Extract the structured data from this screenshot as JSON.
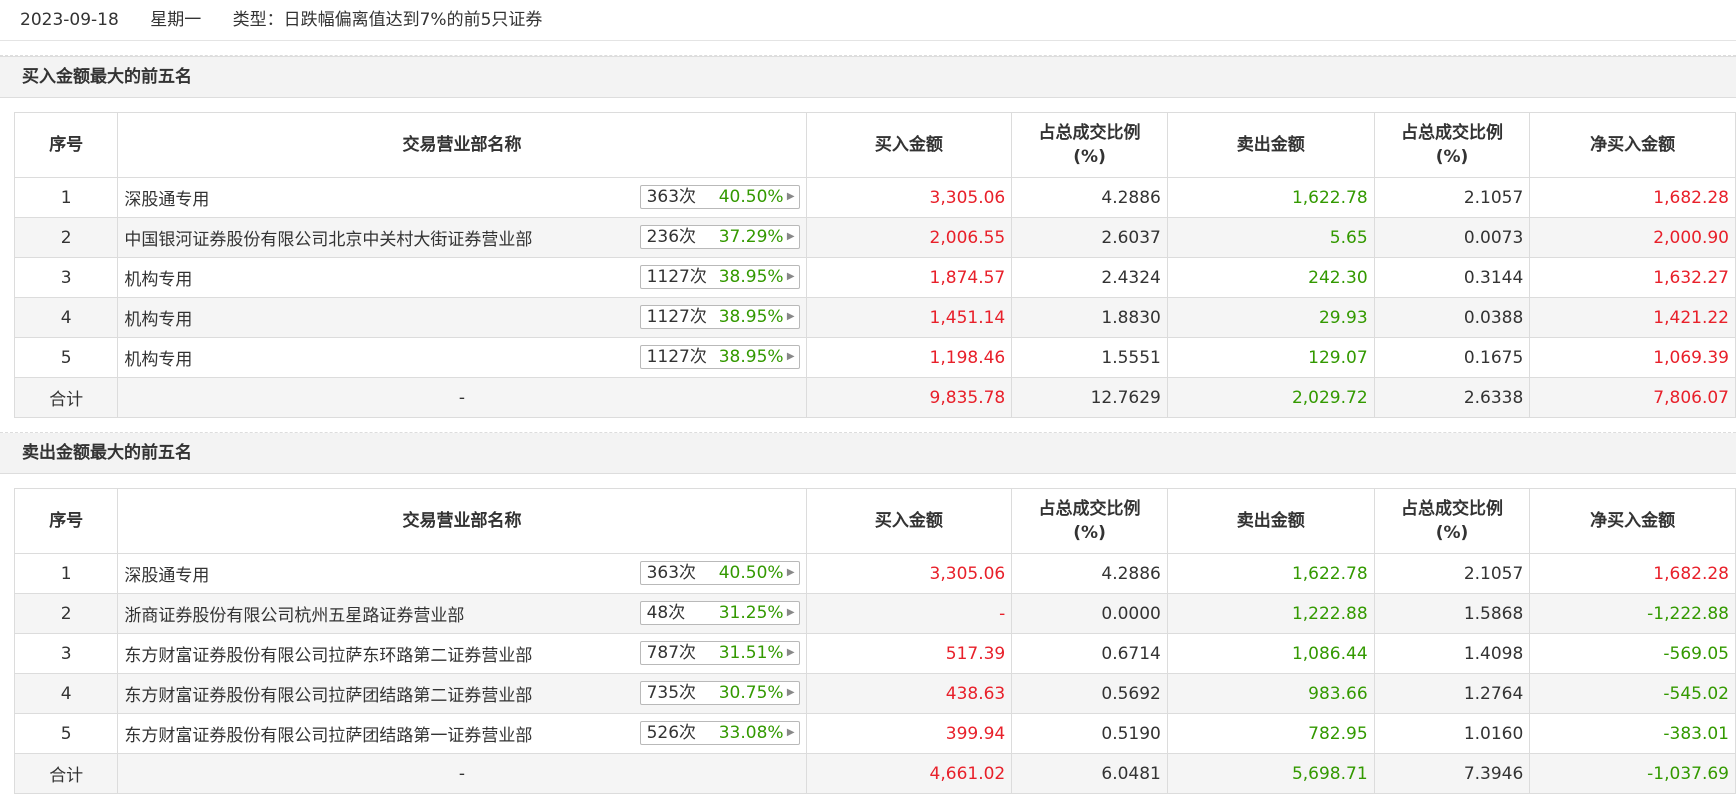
{
  "header": {
    "date": "2023-09-18",
    "weekday": "星期一",
    "type_label": "类型：日跌幅偏离值达到7%的前5只证券"
  },
  "columns": [
    "序号",
    "交易营业部名称",
    "买入金额",
    "占总成交比例\n(%)",
    "卖出金额",
    "占总成交比例\n(%)",
    "净买入金额"
  ],
  "buy_section": {
    "title": "买入金额最大的前五名",
    "rows": [
      {
        "idx": "1",
        "name": "深股通专用",
        "count": "363次",
        "rate": "40.50%",
        "buy": "3,305.06",
        "buy_pct": "4.2886",
        "sell": "1,622.78",
        "sell_pct": "2.1057",
        "net": "1,682.28"
      },
      {
        "idx": "2",
        "name": "中国银河证券股份有限公司北京中关村大街证券营业部",
        "count": "236次",
        "rate": "37.29%",
        "buy": "2,006.55",
        "buy_pct": "2.6037",
        "sell": "5.65",
        "sell_pct": "0.0073",
        "net": "2,000.90"
      },
      {
        "idx": "3",
        "name": "机构专用",
        "count": "1127次",
        "rate": "38.95%",
        "buy": "1,874.57",
        "buy_pct": "2.4324",
        "sell": "242.30",
        "sell_pct": "0.3144",
        "net": "1,632.27"
      },
      {
        "idx": "4",
        "name": "机构专用",
        "count": "1127次",
        "rate": "38.95%",
        "buy": "1,451.14",
        "buy_pct": "1.8830",
        "sell": "29.93",
        "sell_pct": "0.0388",
        "net": "1,421.22"
      },
      {
        "idx": "5",
        "name": "机构专用",
        "count": "1127次",
        "rate": "38.95%",
        "buy": "1,198.46",
        "buy_pct": "1.5551",
        "sell": "129.07",
        "sell_pct": "0.1675",
        "net": "1,069.39"
      }
    ],
    "total": {
      "label": "合计",
      "name": "-",
      "buy": "9,835.78",
      "buy_pct": "12.7629",
      "sell": "2,029.72",
      "sell_pct": "2.6338",
      "net": "7,806.07"
    }
  },
  "sell_section": {
    "title": "卖出金额最大的前五名",
    "rows": [
      {
        "idx": "1",
        "name": "深股通专用",
        "count": "363次",
        "rate": "40.50%",
        "buy": "3,305.06",
        "buy_pct": "4.2886",
        "sell": "1,622.78",
        "sell_pct": "2.1057",
        "net": "1,682.28"
      },
      {
        "idx": "2",
        "name": "浙商证券股份有限公司杭州五星路证券营业部",
        "count": "48次",
        "rate": "31.25%",
        "buy": "-",
        "buy_pct": "0.0000",
        "sell": "1,222.88",
        "sell_pct": "1.5868",
        "net": "-1,222.88"
      },
      {
        "idx": "3",
        "name": "东方财富证券股份有限公司拉萨东环路第二证券营业部",
        "count": "787次",
        "rate": "31.51%",
        "buy": "517.39",
        "buy_pct": "0.6714",
        "sell": "1,086.44",
        "sell_pct": "1.4098",
        "net": "-569.05"
      },
      {
        "idx": "4",
        "name": "东方财富证券股份有限公司拉萨团结路第二证券营业部",
        "count": "735次",
        "rate": "30.75%",
        "buy": "438.63",
        "buy_pct": "0.5692",
        "sell": "983.66",
        "sell_pct": "1.2764",
        "net": "-545.02"
      },
      {
        "idx": "5",
        "name": "东方财富证券股份有限公司拉萨团结路第一证券营业部",
        "count": "526次",
        "rate": "33.08%",
        "buy": "399.94",
        "buy_pct": "0.5190",
        "sell": "782.95",
        "sell_pct": "1.0160",
        "net": "-383.01"
      }
    ],
    "total": {
      "label": "合计",
      "name": "-",
      "buy": "4,661.02",
      "buy_pct": "6.0481",
      "sell": "5,698.71",
      "sell_pct": "7.3946",
      "net": "-1,037.69"
    }
  },
  "colors": {
    "positive": "#e8202a",
    "negative": "#339900",
    "neutral": "#333333"
  },
  "icons": {
    "pill_arrow": "caret-right-icon"
  }
}
